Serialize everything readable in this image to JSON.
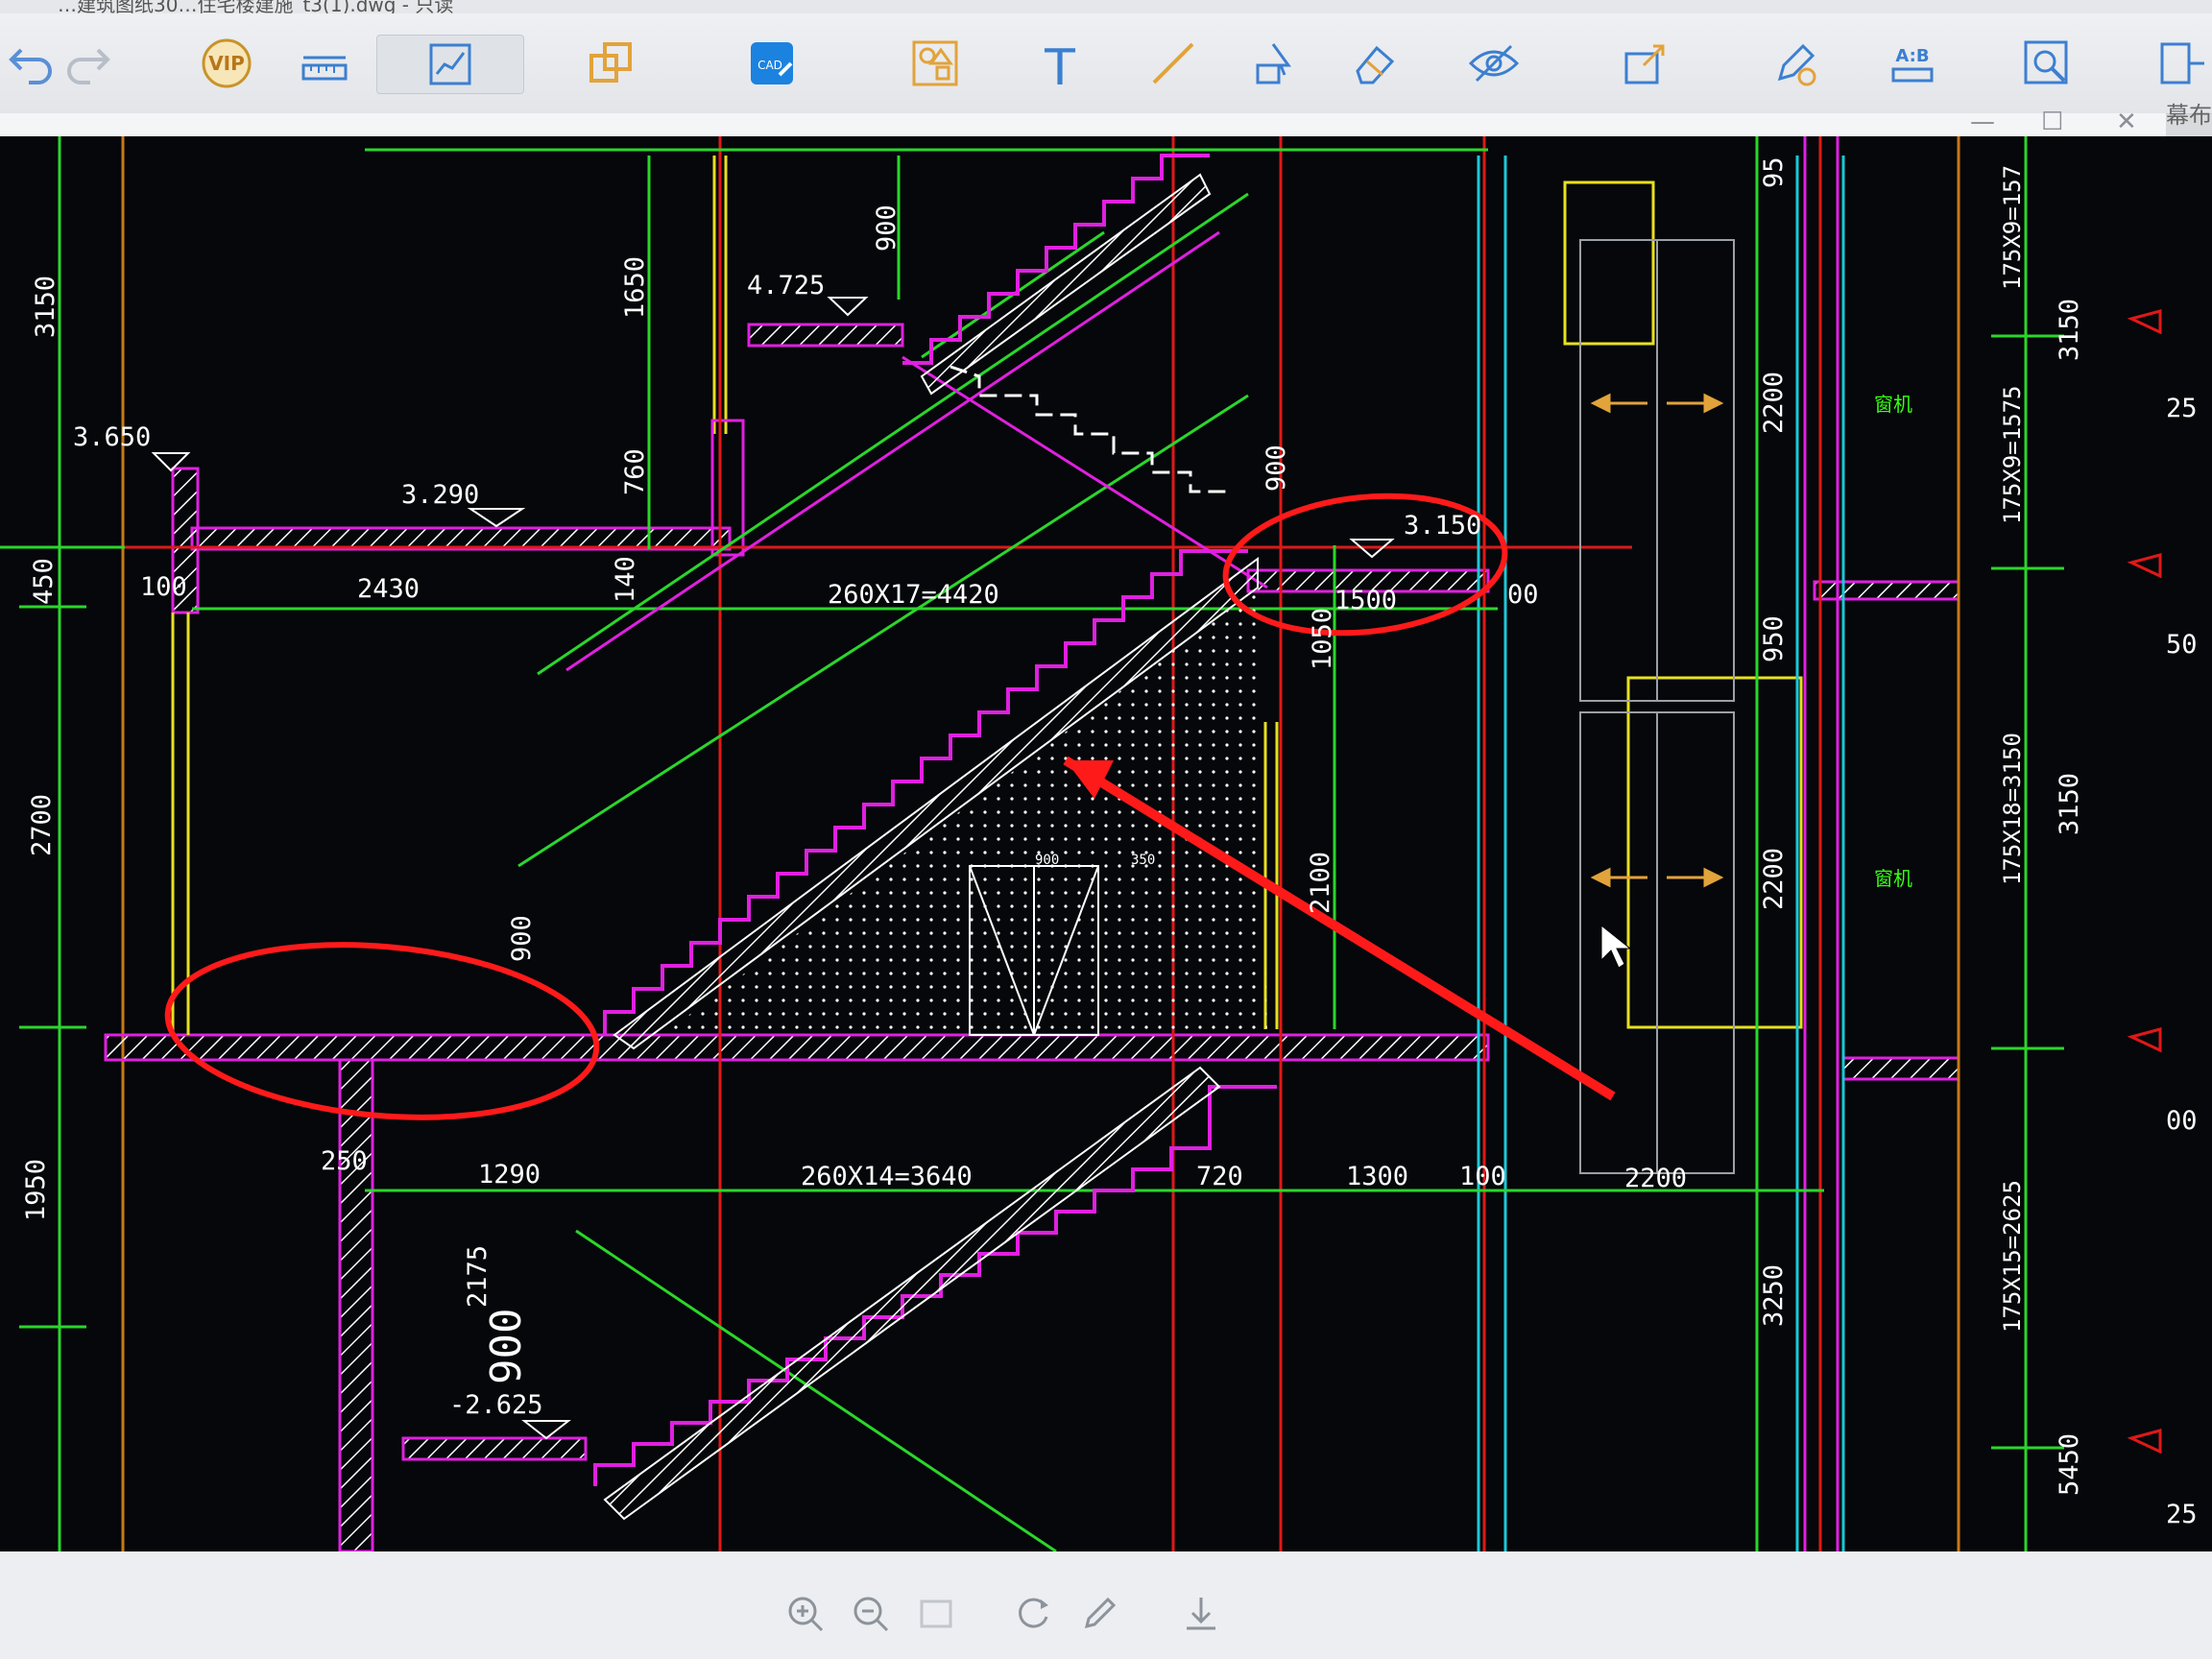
{
  "window": {
    "title": "…建筑图纸30…住宅楼建施_t3(1).dwg - 只读",
    "side_label": "幕布",
    "controls": [
      "—",
      "☐",
      "✕"
    ]
  },
  "toolbar": {
    "vip_label": "VIP",
    "cad_label": "CAD",
    "text_tool": "T",
    "compare_label": "A:B",
    "icons": [
      "undo-icon",
      "redo-icon",
      "vip-icon",
      "measure-icon",
      "chart-icon",
      "copy-icon",
      "cad-icon",
      "shapes-icon",
      "text-icon",
      "line-icon",
      "select-icon",
      "eraser-icon",
      "eye-icon",
      "export-icon",
      "pen-icon",
      "compare-icon",
      "zoom-window-icon",
      "side-icon"
    ]
  },
  "drawing": {
    "levels": [
      "4.725",
      "3.650",
      "3.290",
      "3.150",
      "-2.625"
    ],
    "left_dims": [
      "3150",
      "450",
      "2700",
      "1950"
    ],
    "dims": {
      "d900a": "900",
      "d1650": "1650",
      "d760": "760",
      "d140": "140",
      "d100a": "100",
      "d2430": "2430",
      "d4420": "260X17=4420",
      "d900b": "900",
      "d1500": "1500",
      "d00": "00",
      "d1050": "1050",
      "d2100": "2100",
      "d900c": "900",
      "d250": "250",
      "d1290": "1290",
      "d3640": "260X14=3640",
      "d720": "720",
      "d1300": "1300",
      "d100b": "100",
      "d2200h": "2200",
      "d2175": "2175",
      "d900big": "900",
      "d2200v1": "2200",
      "d950": "950",
      "d2200v2": "2200",
      "d3250": "3250",
      "d95": "95",
      "w900": "900",
      "w350": "350"
    },
    "right_dims": [
      "175X9=157",
      "175X9=1575",
      "175X18=3150",
      "175X15=2625",
      "3150",
      "3150",
      "5450"
    ],
    "edge_marks": [
      "25",
      "50",
      "00",
      "25"
    ],
    "room_tags": [
      "窗机",
      "窗机"
    ]
  },
  "viewer": {
    "icons": [
      "zoom-in-icon",
      "zoom-out-icon",
      "fit-icon",
      "rotate-icon",
      "edit-icon",
      "download-icon"
    ]
  },
  "colors": {
    "background": "#05070a",
    "green": "#2bd62b",
    "magenta": "#e020e0",
    "red": "#e01818",
    "yellow": "#e8e020",
    "cyan": "#1cc8d8",
    "orange": "#c87818",
    "annotation": "#ff1a1a",
    "white": "#ffffff",
    "toolbar_icon": "#3c7fd0"
  }
}
